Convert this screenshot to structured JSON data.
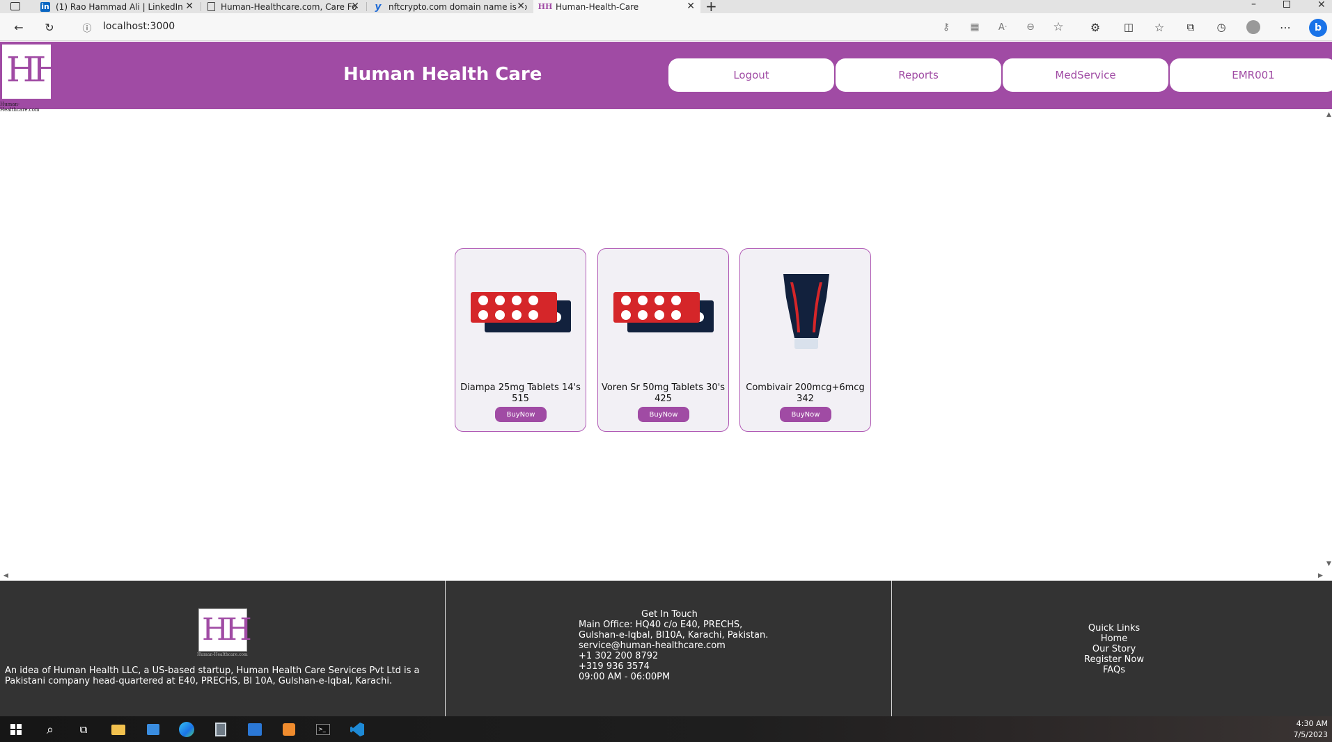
{
  "browser": {
    "tabs": [
      {
        "title": "(1) Rao Hammad Ali | LinkedIn",
        "icon": "linkedin-icon"
      },
      {
        "title": "Human-Healthcare.com, Care Fo",
        "icon": "page-icon"
      },
      {
        "title": "nftcrypto.com domain name is fo",
        "icon": "yahoo-icon"
      },
      {
        "title": "Human-Health-Care",
        "icon": "hh-icon"
      }
    ],
    "new_tab": "+",
    "url": "localhost:3000"
  },
  "header": {
    "logo_text": "HH",
    "logo_caption": "Human-Healthcare.com",
    "title": "Human Health Care",
    "nav": [
      "Logout",
      "Reports",
      "MedService",
      "EMR001"
    ]
  },
  "products": [
    {
      "name": "Diampa 25mg Tablets 14's",
      "price": "515",
      "button": "BuyNow",
      "image": "tablet-blister"
    },
    {
      "name": "Voren Sr 50mg Tablets 30's",
      "price": "425",
      "button": "BuyNow",
      "image": "tablet-blister"
    },
    {
      "name": "Combivair 200mcg+6mcg",
      "price": "342",
      "button": "BuyNow",
      "image": "tube"
    }
  ],
  "footer": {
    "logo_text": "HH",
    "logo_caption": "Human-Healthcare.com",
    "about": "An idea of Human Health LLC, a US-based startup, Human Health Care Services Pvt Ltd is a Pakistani company head-quartered at E40, PRECHS, Bl 10A, Gulshan-e-Iqbal, Karachi.",
    "contact": {
      "heading": "Get In Touch",
      "lines": [
        "Main Office: HQ40 c/o E40, PRECHS,",
        "Gulshan-e-Iqbal, Bl10A, Karachi, Pakistan.",
        "service@human-healthcare.com",
        "+1 302 200 8792",
        "+319 936 3574",
        "09:00 AM - 06:00PM"
      ]
    },
    "quick_links": {
      "heading": "Quick Links",
      "items": [
        "Home",
        "Our Story",
        "Register Now",
        "FAQs"
      ]
    }
  },
  "taskbar": {
    "time": "4:30 AM",
    "date": "7/5/2023"
  },
  "colors": {
    "brand": "#a04ba4",
    "footer_bg": "#333333"
  }
}
